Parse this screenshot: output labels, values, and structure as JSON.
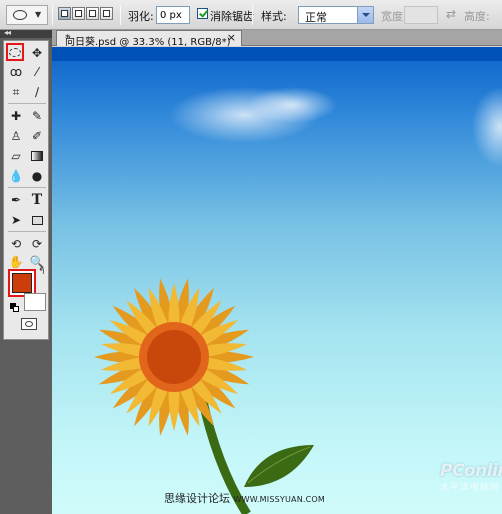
{
  "options_bar": {
    "tool_preset_icon": "elliptical-marquee-icon",
    "feather_label": "羽化:",
    "feather_value": "0 px",
    "antialias_label": "消除锯齿",
    "antialias_checked": true,
    "style_label": "样式:",
    "style_value": "正常",
    "width_label": "宽度:",
    "height_label": "高度:"
  },
  "document": {
    "tab_title": "向日葵.psd @ 33.3% (11, RGB/8*)",
    "tab_modified_mark": "*",
    "close_glyph": "×"
  },
  "toolbox": {
    "collapse_glyph": "◂◂",
    "tools": [
      "elliptical-marquee-icon",
      "move-icon",
      "lasso-icon",
      "magic-wand-icon",
      "crop-icon",
      "eyedropper-icon",
      "healing-brush-icon",
      "brush-icon",
      "clone-stamp-icon",
      "history-brush-icon",
      "eraser-icon",
      "gradient-icon",
      "blur-icon",
      "dodge-icon",
      "pen-icon",
      "type-icon",
      "path-selection-icon",
      "rectangle-icon",
      "3d-rotate-icon",
      "3d-orbit-icon",
      "hand-icon",
      "zoom-icon"
    ],
    "foreground_color": "#cc3d0a",
    "background_color": "#ffffff"
  },
  "watermark": {
    "logo": "PConline",
    "logo_sub": "太平洋电脑网",
    "forum": "思缘设计论坛",
    "url": "WWW.MISSYUAN.COM"
  },
  "colors": {
    "highlight_red": "#e21818",
    "sky_top": "#0a63c9",
    "sky_bottom": "#d0fbfb",
    "petal": "#f0b22c",
    "center_ring": "#e2651c",
    "center": "#c8470b",
    "stem": "#3a6a14"
  }
}
